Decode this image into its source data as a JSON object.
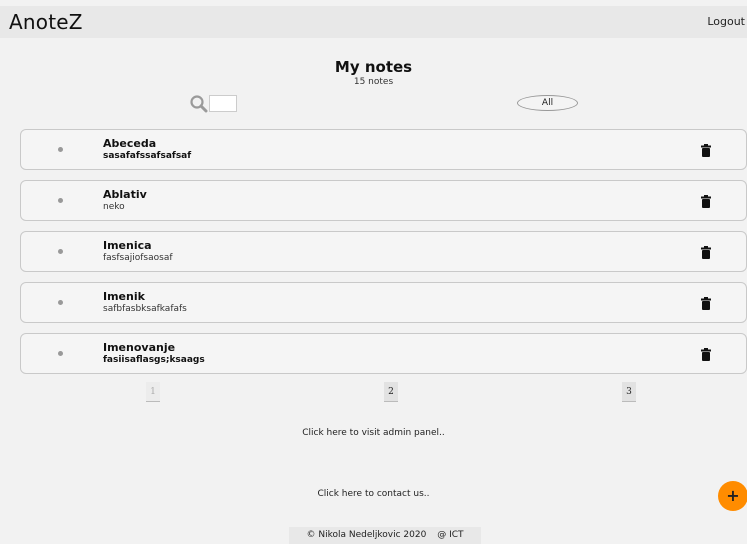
{
  "header": {
    "logo": "AnoteZ",
    "logout_label": "Logout"
  },
  "main": {
    "title": "My notes",
    "count": "15 notes",
    "search": {
      "value": "",
      "placeholder": ""
    },
    "filter_label": "All"
  },
  "notes": [
    {
      "title": "Abeceda",
      "body": "sasafafssafsafsaf"
    },
    {
      "title": "Ablativ",
      "body": "neko"
    },
    {
      "title": "Imenica",
      "body": "fasfsajiofsaosaf"
    },
    {
      "title": "Imenik",
      "body": "safbfasbksafkafafs"
    },
    {
      "title": "Imenovanje",
      "body": "fasiisaflasgs;ksaags"
    }
  ],
  "pagination": [
    "1",
    "2",
    "3"
  ],
  "links": {
    "admin": "Click here to visit admin panel..",
    "contact": "Click here to contact us.."
  },
  "fab_label": "+",
  "footer": {
    "copyright": "© Nikola Nedeljkovic 2020",
    "org": "@ ICT"
  },
  "colors": {
    "accent": "#ff8c00",
    "header_bg": "#e8e8e8",
    "page_bg": "#f2f2f2"
  }
}
